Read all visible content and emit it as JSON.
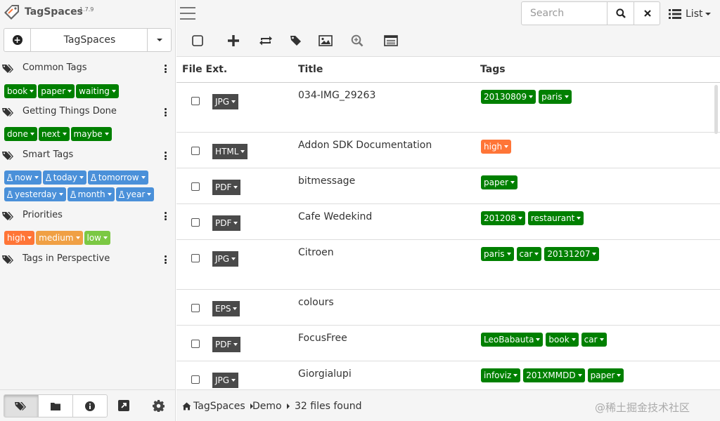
{
  "app": {
    "name": "TagSpaces",
    "version": "1.7.9"
  },
  "location": {
    "name": "TagSpaces"
  },
  "colors": {
    "green": "#008000",
    "orange": "#ff7537",
    "light_orange": "#f0a044",
    "light_green": "#7bc843",
    "smart_blue": "#4a90d9",
    "ext_dark": "#4a4a4a"
  },
  "tag_groups": [
    {
      "title": "Common Tags",
      "tags": [
        "book",
        "paper",
        "waiting"
      ]
    },
    {
      "title": "Getting Things Done",
      "tags": [
        "done",
        "next",
        "maybe"
      ]
    },
    {
      "title": "Smart Tags",
      "tags": [
        "now",
        "today",
        "tomorrow",
        "yesterday",
        "month",
        "year"
      ]
    },
    {
      "title": "Priorities",
      "tags": [
        "high",
        "medium",
        "low"
      ]
    },
    {
      "title": "Tags in Perspective",
      "tags": []
    }
  ],
  "search": {
    "placeholder": "Search"
  },
  "view": {
    "label": "List"
  },
  "table": {
    "headers": {
      "file_ext": "File Ext.",
      "title": "Title",
      "tags": "Tags"
    },
    "rows": [
      {
        "ext": "JPG",
        "title": "034-IMG_29263",
        "tags": [
          "20130809",
          "paris"
        ]
      },
      {
        "ext": "HTML",
        "title": "Addon SDK Documentation",
        "tags": [
          "high"
        ]
      },
      {
        "ext": "PDF",
        "title": "bitmessage",
        "tags": [
          "paper"
        ]
      },
      {
        "ext": "PDF",
        "title": "Cafe Wedekind",
        "tags": [
          "201208",
          "restaurant"
        ]
      },
      {
        "ext": "JPG",
        "title": "Citroen",
        "tags": [
          "paris",
          "car",
          "20131207"
        ]
      },
      {
        "ext": "EPS",
        "title": "colours",
        "tags": []
      },
      {
        "ext": "PDF",
        "title": "FocusFree",
        "tags": [
          "LeoBabauta",
          "book",
          "car"
        ]
      },
      {
        "ext": "JPG",
        "title": "Giorgialupi",
        "tags": [
          "infoviz",
          "201XMMDD",
          "paper"
        ]
      }
    ]
  },
  "status": {
    "crumb1": "TagSpaces",
    "crumb2": "Demo",
    "count": "32 files found"
  },
  "watermark": "@稀土掘金技术社区"
}
